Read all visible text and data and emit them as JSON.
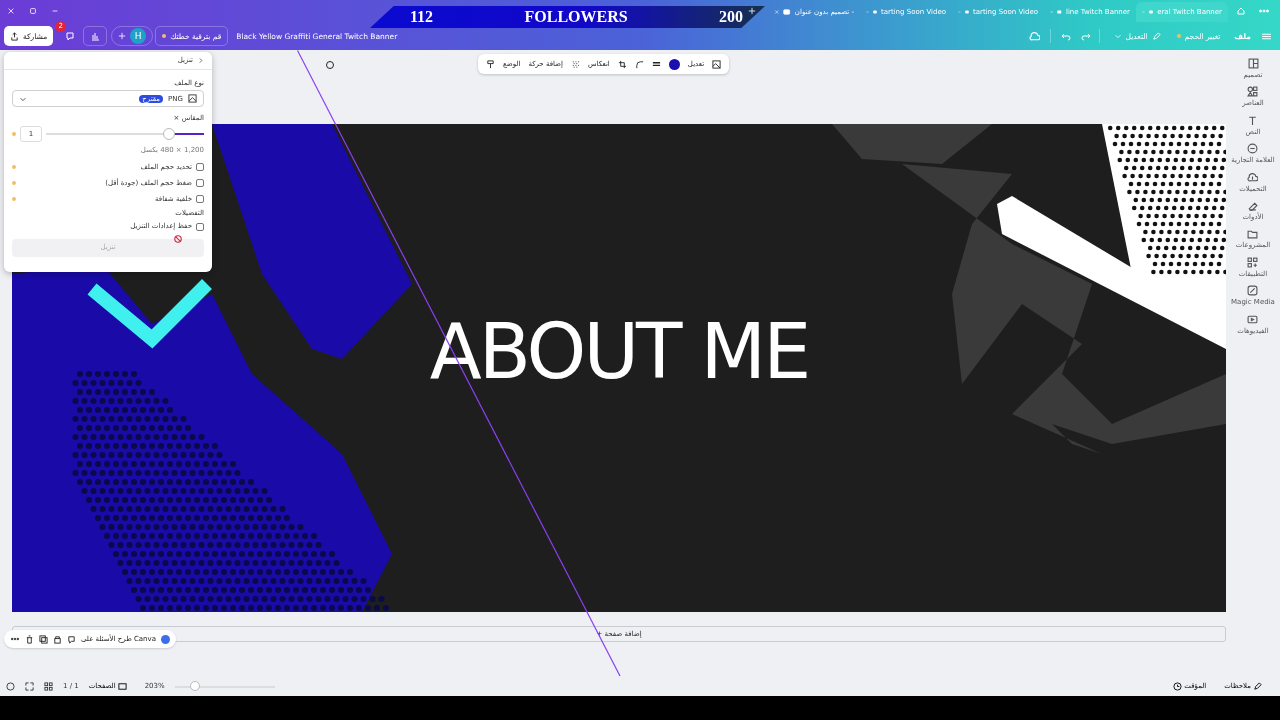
{
  "overlay_banner": {
    "left_number": "112",
    "label": "FOLLOWERS",
    "right_number": "200"
  },
  "browser_tabs": [
    {
      "label": "eral Twitch Banner",
      "selected": true
    },
    {
      "label": "line Twitch Banner",
      "selected": false
    },
    {
      "label": "tarting Soon Video",
      "selected": false
    },
    {
      "label": "tarting Soon Video",
      "selected": false
    },
    {
      "label": "تصميم بدون عنوان -",
      "selected": false
    }
  ],
  "toolbar": {
    "share": "مشاركة",
    "comments_badge": "2",
    "avatar": "H",
    "upgrade": "قم بترقية خطتك",
    "design_title": "Black Yellow Graffiti General Twitch Banner",
    "edit_menu": "التعديل",
    "resize": "تغيير الحجم",
    "file_menu": "ملف"
  },
  "element_toolbar": {
    "position": "الوضع",
    "animate": "إضافة حركة",
    "flip": "انعكاس",
    "edit": "تعديل"
  },
  "download_panel": {
    "title": "تنزيل",
    "file_type_label": "نوع الملف",
    "file_type": "PNG",
    "recommended_badge": "مقترح",
    "size_label": "المقاس ×",
    "scale": "1",
    "scale_slider": {
      "level": 0.22
    },
    "dimensions": "1,200 × 480 بكسل",
    "options": [
      {
        "label": "تحديد حجم الملف",
        "checked": false
      },
      {
        "label": "ضغط حجم الملف (جودة أقل)",
        "checked": false
      },
      {
        "label": "خلفية شفافة",
        "checked": false
      }
    ],
    "preferences_label": "التفضيلات",
    "preferences": [
      {
        "label": "حفظ إعدادات التنزيل",
        "checked": false
      }
    ],
    "download_button": {
      "label": "تنزيل",
      "disabled": true
    }
  },
  "canvas": {
    "heading": "ABOUT ME"
  },
  "add_page": "+ إضافة صفحة",
  "assistant_pill": "طرح الأسئلة على Canva",
  "side_panel": [
    {
      "label": "تصميم"
    },
    {
      "label": "العناصر"
    },
    {
      "label": "النص"
    },
    {
      "label": "العلامة التجارية"
    },
    {
      "label": "التحميلات"
    },
    {
      "label": "الأدوات"
    },
    {
      "label": "المشروعات"
    },
    {
      "label": "التطبيقات"
    },
    {
      "label": "Magic Media"
    },
    {
      "label": "الفيديوهات"
    }
  ],
  "status_bar": {
    "notes": "ملاحظات",
    "timer": "المؤقت",
    "zoom": "203%",
    "zoom_slider": {
      "level": 0.2
    },
    "pages": "الصفحات",
    "page_count": "1 / 1"
  }
}
